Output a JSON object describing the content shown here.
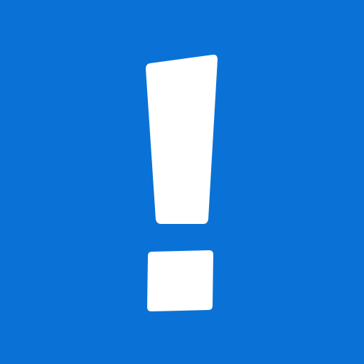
{
  "icon": {
    "semantic_name": "exclamation-mark-icon",
    "background_color": "#0a72d6",
    "foreground_color": "#ffffff"
  }
}
